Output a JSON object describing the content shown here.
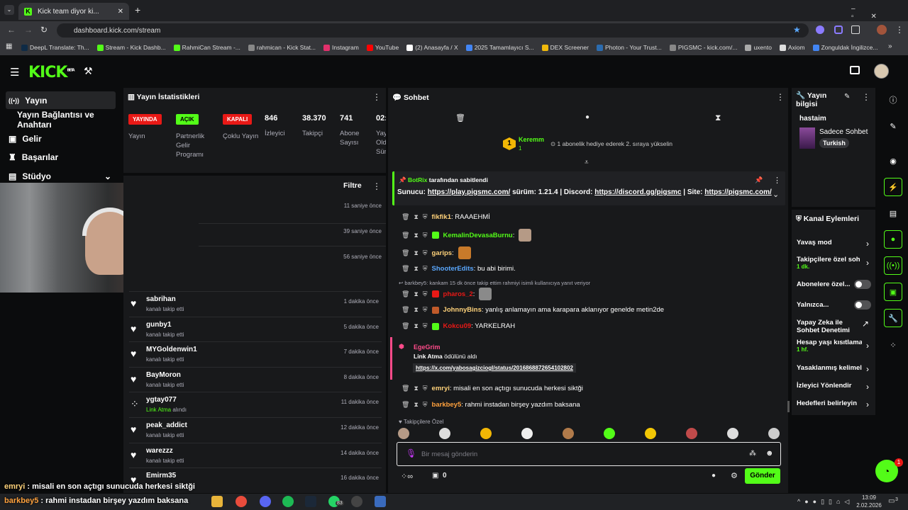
{
  "browser": {
    "tab_title": "Kick team diyor ki...",
    "url": "dashboard.kick.com/stream",
    "bookmarks": [
      "DeepL Translate: Th...",
      "Stream - Kick Dashb...",
      "RahmiCan Stream -...",
      "rahmican - Kick Stat...",
      "Instagram",
      "YouTube",
      "(2) Anasayfa / X",
      "2025 Tamamlayıcı S...",
      "DEX Screener",
      "Photon - Your Trust...",
      "PIGSMC - kick.com/...",
      "uxento",
      "Axiom",
      "Zonguldak İngilizce..."
    ]
  },
  "brand": {
    "logo": "KICK",
    "beta": "BETA",
    "accent": "#53fc18"
  },
  "nav": {
    "items": [
      "Yayın",
      "Yayın Bağlantısı ve Anahtarı",
      "Gelir",
      "Başarılar",
      "Stüdyo"
    ]
  },
  "stats": {
    "title": "Yayın İstatistikleri",
    "badges": [
      {
        "text": "YAYINDA",
        "label": "Yayın",
        "color": "#e91916"
      },
      {
        "text": "AÇIK",
        "label": "Partnerlik Gelir Programı",
        "color": "#53fc18"
      },
      {
        "text": "KAPALI",
        "label": "Çoklu Yayın",
        "color": "#e91916"
      }
    ],
    "numbers": [
      {
        "value": "846",
        "label": "İzleyici"
      },
      {
        "value": "38.370",
        "label": "Takipçi"
      },
      {
        "value": "741",
        "label": "Abone Sayısı"
      },
      {
        "value": "02:",
        "label": "Yay Old Sür"
      }
    ]
  },
  "feed": {
    "filter_label": "Filtre",
    "times_top": [
      "11 saniye önce",
      "39 saniye önce",
      "56 saniye önce"
    ],
    "rows": [
      {
        "name": "sabrihan",
        "sub": "kanalı takip etti",
        "time": "1 dakika önce"
      },
      {
        "name": "gunby1",
        "sub": "kanalı takip etti",
        "time": "5 dakika önce"
      },
      {
        "name": "MYGoldenwin1",
        "sub": "kanalı takip etti",
        "time": "7 dakika önce"
      },
      {
        "name": "BayMoron",
        "sub": "kanalı takip etti",
        "time": "8 dakika önce"
      },
      {
        "name": "ygtay077",
        "sub_hl": "Link Atma",
        "sub": "alındı",
        "time": "11 dakika önce"
      },
      {
        "name": "peak_addict",
        "sub": "kanalı takip etti",
        "time": "12 dakika önce"
      },
      {
        "name": "warezzz",
        "sub": "kanalı takip etti",
        "time": "14 dakika önce"
      },
      {
        "name": "Emirm35",
        "sub": "",
        "time": "16 dakika önce"
      }
    ]
  },
  "chat": {
    "title": "Sohbet",
    "top_gifter": {
      "rank": "1",
      "name": "Keremm",
      "count": "1",
      "text": "1 abonelik hediye ederek 2. sıraya yükselin"
    },
    "pinned": {
      "by": "BotRix",
      "by_suffix": "tarafından sabitlendi",
      "server_label": "Sunucu:",
      "server_url": "https://play.pigsmc.com/",
      "version": "sürüm: 1.21.4 |",
      "discord_label": "Discord:",
      "discord_url": "https://discord.gg/pigsmc",
      "site_label": "| Site:",
      "site_url": "https://pigsmc.com/"
    },
    "messages": [
      {
        "user": "fikfik1",
        "color": "#ffd27a",
        "text": "RAAAEHMİ"
      },
      {
        "user": "KemalinDevasaBurnu",
        "color": "#53fc18",
        "text": ""
      },
      {
        "user": "garips",
        "color": "#ffd27a",
        "text": ""
      },
      {
        "user": "ShooterEdits",
        "color": "#5aa8ff",
        "text": "bu abi birimi."
      },
      {
        "user": "pharos_2",
        "color": "#e91916",
        "text": ""
      },
      {
        "user": "JohnnyBins",
        "color": "#ffd27a",
        "text": "yanlış anlamayın ama karapara aklanıyor genelde metin2de"
      },
      {
        "user": "Kokcu09",
        "color": "#e91916",
        "text": "YARKELRAH"
      },
      {
        "user": "emryi",
        "color": "#ffd27a",
        "text": "misali en son açtıgı sunucuda herkesi siktği"
      },
      {
        "user": "barkbey5",
        "color": "#ffa13d",
        "text": "rahmi instadan birşey yazdım baksana"
      }
    ],
    "reply_note": "barkbey5: kankam 15 dk önce takip ettim rahmiyi isimli kullanıcıya yanıt veriyor",
    "reward": {
      "user": "EgeGrim",
      "title": "Link Atma",
      "title_suffix": "ödülünü aldı",
      "link": "https://x.com/yabosagizciogl/status/2016868872654102802"
    },
    "emote_header": "Takipçilere Özel",
    "input_placeholder": "Bir mesaj gönderin",
    "count": "0",
    "send_label": "Gönder"
  },
  "streaminfo": {
    "title": "Yayın bilgisi",
    "name": "hastaim",
    "category": "Sadece Sohbet",
    "tag": "Turkish"
  },
  "actions": {
    "title": "Kanal Eylemleri",
    "items": [
      {
        "label": "Yavaş mod",
        "sub": ""
      },
      {
        "label": "Takipçilere özel soh",
        "sub": "1 dk."
      },
      {
        "label": "Abonelere özel...",
        "sub": ""
      },
      {
        "label": "Yalnızca...",
        "sub": ""
      },
      {
        "label": "Yapay Zeka ile Sohbet Denetimi",
        "sub": ""
      },
      {
        "label": "Hesap yaşı kısıtlama",
        "sub": "1 hf."
      },
      {
        "label": "Yasaklanmış kelimel",
        "sub": ""
      },
      {
        "label": "İzleyici Yönlendir",
        "sub": ""
      },
      {
        "label": "Hedefleri belirleyin",
        "sub": ""
      }
    ]
  },
  "overlay": {
    "line1_user": "emryi",
    "line1": "misali en son açtıgı sunucuda herkesi siktği",
    "line2_user": "barkbey5",
    "line2": "rahmi instadan birşey yazdım baksana"
  },
  "system": {
    "time": "13:09",
    "date": "2.02.2026",
    "badge": "83",
    "notif": "3"
  },
  "help_badge": "1"
}
